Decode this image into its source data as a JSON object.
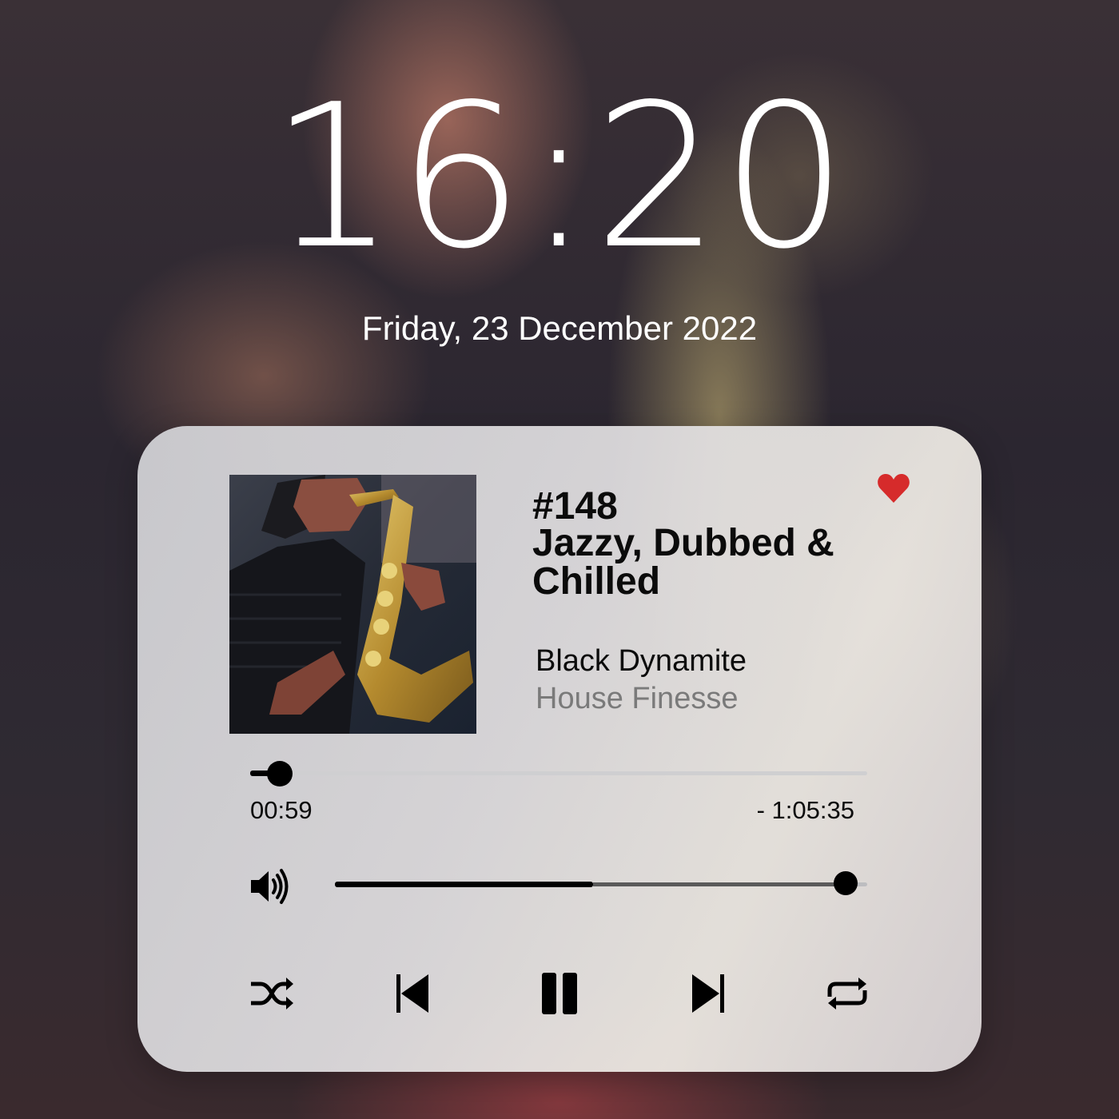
{
  "lockscreen": {
    "time": "16:20",
    "date": "Friday, 23 December 2022"
  },
  "player": {
    "track_number": "#148",
    "track_title": "Jazzy, Dubbed & Chilled",
    "artist": "Black Dynamite",
    "album": "House Finesse",
    "favorite": true,
    "elapsed": "00:59",
    "remaining": "- 1:05:35",
    "progress_fraction": 0.048,
    "volume_fraction": 0.96,
    "volume_dark_fraction": 0.485,
    "controls": [
      "shuffle-icon",
      "previous-icon",
      "pause-icon",
      "next-icon",
      "repeat-icon"
    ],
    "colors": {
      "heart": "#d62b2b",
      "text": "#0b0b0b",
      "subtext": "#7a7a7a",
      "card": "#dcdadd"
    }
  }
}
